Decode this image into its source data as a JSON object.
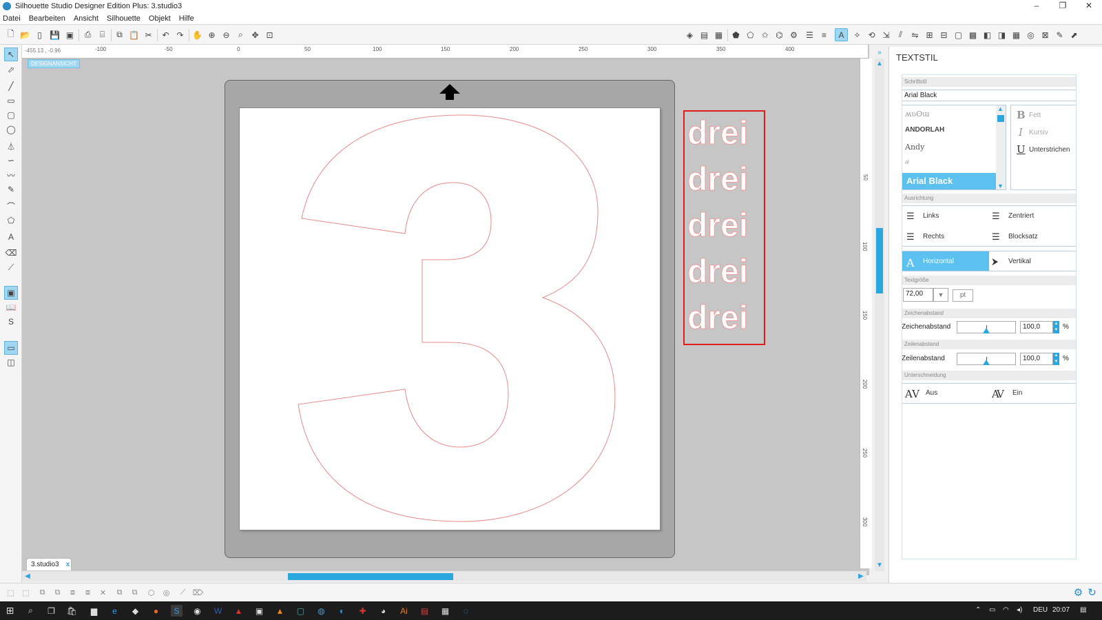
{
  "window": {
    "title": "Silhouette Studio Designer Edition Plus: 3.studio3",
    "min": "–",
    "max": "❐",
    "close": "✕"
  },
  "menu": [
    "Datei",
    "Bearbeiten",
    "Ansicht",
    "Silhouette",
    "Objekt",
    "Hilfe"
  ],
  "canvas": {
    "badge": "DESIGNANSICHT",
    "coords": "-455.13 , -0.96",
    "ruler_h": [
      "-100",
      "-50",
      "0",
      "50",
      "100",
      "150",
      "200",
      "250",
      "300",
      "350",
      "400"
    ],
    "ruler_v": [
      "50",
      "100",
      "150",
      "200",
      "250",
      "300"
    ],
    "big_glyph": "3",
    "drei_words": [
      "drei",
      "drei",
      "drei",
      "drei",
      "drei"
    ]
  },
  "tab": {
    "label": "3.studio3",
    "close": "x"
  },
  "panel": {
    "title": "TEXTSTIL",
    "font_section": "Schriftstil",
    "font_input": "Arial Black",
    "font_list": [
      "ʍʋʘɯ",
      "ANDORLAH",
      "Andy",
      "ᵃˡ"
    ],
    "font_selected": "Arial Black",
    "styles": {
      "bold": "Fett",
      "italic": "Kursiv",
      "underline": "Unterstrichen"
    },
    "align_section": "Ausrichtung",
    "align": {
      "left": "Links",
      "center": "Zentriert",
      "right": "Rechts",
      "justify": "Blocksatz"
    },
    "direction": {
      "horizontal": "Horizontal",
      "vertical": "Vertikal"
    },
    "size_section": "Textgröße",
    "size_value": "72,00",
    "size_unit": "pt",
    "char_section": "Zeichenabstand",
    "char_label": "Zeichenabstand",
    "char_value": "100,0",
    "line_section": "Zeilenabstand",
    "line_label": "Zeilenabstand",
    "line_value": "100,0",
    "percent": "%",
    "kern_section": "Unterschneidung",
    "kern_off": "Aus",
    "kern_on": "Ein"
  },
  "taskbar": {
    "lang": "DEU",
    "time": "20:07"
  }
}
